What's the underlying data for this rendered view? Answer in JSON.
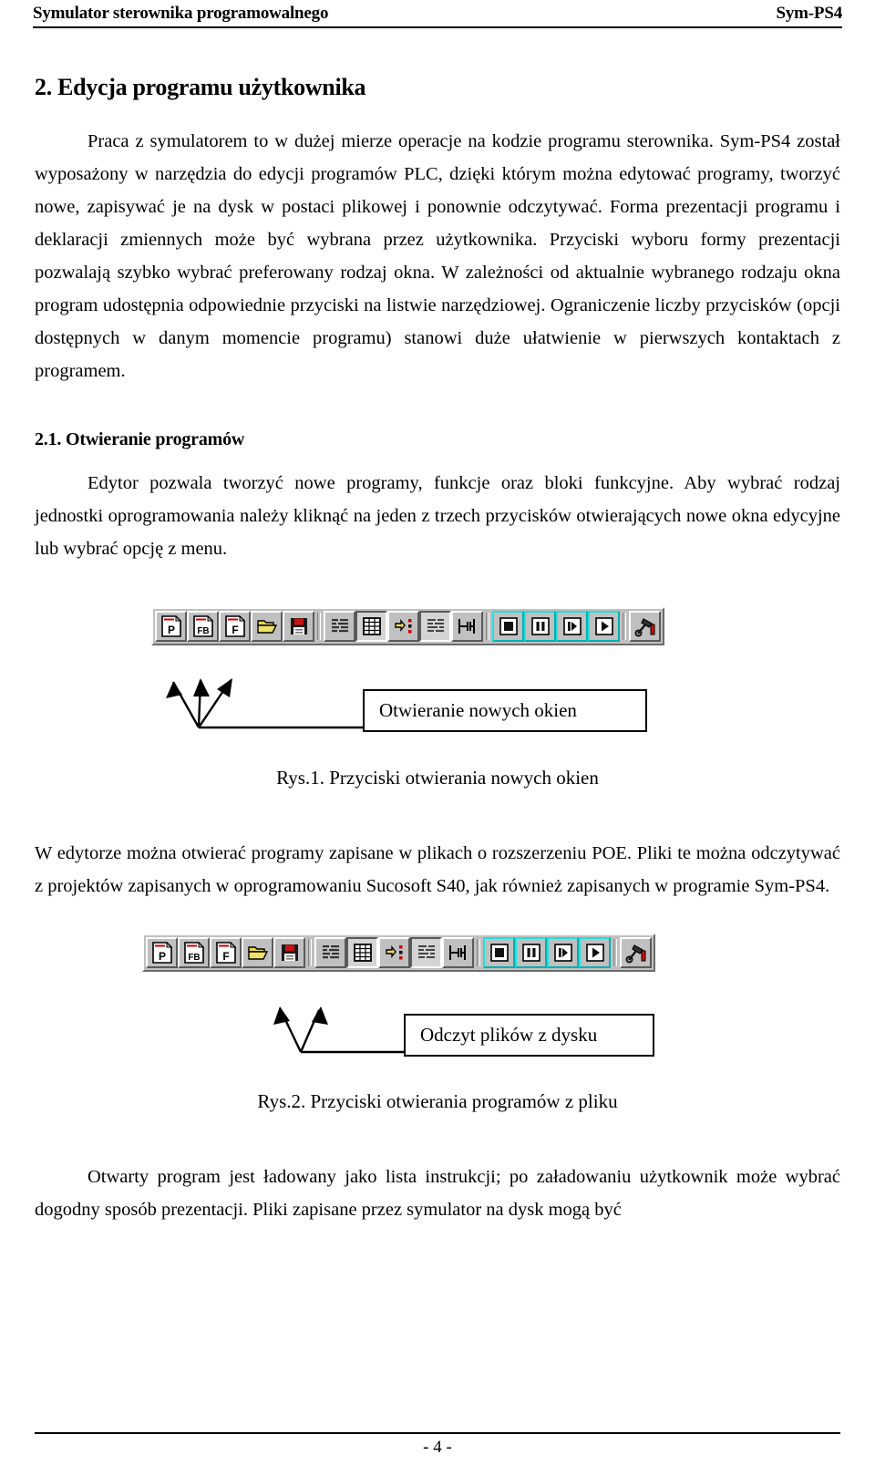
{
  "header": {
    "left": "Symulator sterownika programowalnego",
    "right": "Sym-PS4"
  },
  "section": {
    "heading": "2. Edycja programu użytkownika",
    "paragraph_1": "Praca z symulatorem to w dużej mierze operacje na kodzie programu sterownika. Sym-PS4 został wyposażony w narzędzia do edycji programów PLC, dzięki którym można edytować programy, tworzyć nowe, zapisywać je na dysk w postaci plikowej i ponownie odczytywać. Forma prezentacji programu i deklaracji zmiennych może być wybrana przez użytkownika. Przyciski wyboru formy prezentacji pozwalają szybko wybrać preferowany rodzaj okna. W zależności od aktualnie wybranego rodzaju okna program udostępnia odpowiednie przyciski na listwie narzędziowej. Ograniczenie liczby przycisków (opcji dostępnych w danym momencie programu) stanowi duże ułatwienie w pierwszych kontaktach z programem."
  },
  "subsection": {
    "heading": "2.1. Otwieranie programów",
    "paragraph_1": "Edytor pozwala tworzyć nowe programy, funkcje oraz bloki funkcyjne. Aby wybrać rodzaj jednostki oprogramowania należy kliknąć na jeden z trzech przycisków otwierających nowe okna edycyjne lub wybrać opcję z menu.",
    "paragraph_2": "W edytorze można otwierać programy zapisane w plikach o rozszerzeniu POE. Pliki te można odczytywać z projektów zapisanych w oprogramowaniu Sucosoft S40, jak również zapisanych w programie Sym-PS4.",
    "paragraph_3": "Otwarty program jest ładowany jako lista instrukcji; po załadowaniu użytkownik może wybrać dogodny sposób prezentacji. Pliki zapisane przez symulator na dysk mogą być"
  },
  "toolbar": {
    "buttons": [
      {
        "name": "new-program-button",
        "icon": "page-p-icon",
        "label": "P",
        "state": "normal"
      },
      {
        "name": "new-function-block-button",
        "icon": "page-fb-icon",
        "label": "FB",
        "state": "normal"
      },
      {
        "name": "new-function-button",
        "icon": "page-f-icon",
        "label": "F",
        "state": "normal"
      },
      {
        "name": "open-file-button",
        "icon": "open-folder-icon",
        "label": "",
        "state": "normal"
      },
      {
        "name": "save-file-button",
        "icon": "floppy-disk-icon",
        "label": "",
        "state": "normal"
      },
      {
        "name": "instruction-list-view-button",
        "icon": "instruction-list-icon",
        "label": "",
        "state": "normal"
      },
      {
        "name": "table-view-button",
        "icon": "grid-table-icon",
        "label": "",
        "state": "pressed"
      },
      {
        "name": "variable-declaration-button",
        "icon": "hand-pointer-icon",
        "label": "",
        "state": "normal"
      },
      {
        "name": "source-text-view-button",
        "icon": "dotted-text-icon",
        "label": "",
        "state": "pressed"
      },
      {
        "name": "ladder-view-button",
        "icon": "ladder-rung-icon",
        "label": "",
        "state": "normal"
      },
      {
        "name": "stop-button",
        "icon": "stop-square-icon",
        "label": "",
        "state": "cyan"
      },
      {
        "name": "pause-button",
        "icon": "pause-bars-icon",
        "label": "",
        "state": "cyan"
      },
      {
        "name": "step-button",
        "icon": "step-forward-icon",
        "label": "",
        "state": "cyan"
      },
      {
        "name": "run-button",
        "icon": "play-triangle-icon",
        "label": "",
        "state": "cyan"
      },
      {
        "name": "build-tools-button",
        "icon": "hammer-wrench-icon",
        "label": "",
        "state": "normal"
      }
    ]
  },
  "figure_1": {
    "callout": "Otwieranie nowych okien",
    "caption": "Rys.1. Przyciski otwierania nowych okien",
    "arrow_count": 3
  },
  "figure_2": {
    "callout": "Odczyt plików z dysku",
    "caption": "Rys.2. Przyciski otwierania programów z pliku",
    "arrow_count": 2
  },
  "footer": {
    "page_number": "- 4 -"
  },
  "colors": {
    "toolbar_face": "#c0c0c0",
    "accent_cyan": "#00d8d8",
    "icon_red": "#cc0000",
    "icon_yellow": "#e8d84a",
    "text": "#000000"
  }
}
